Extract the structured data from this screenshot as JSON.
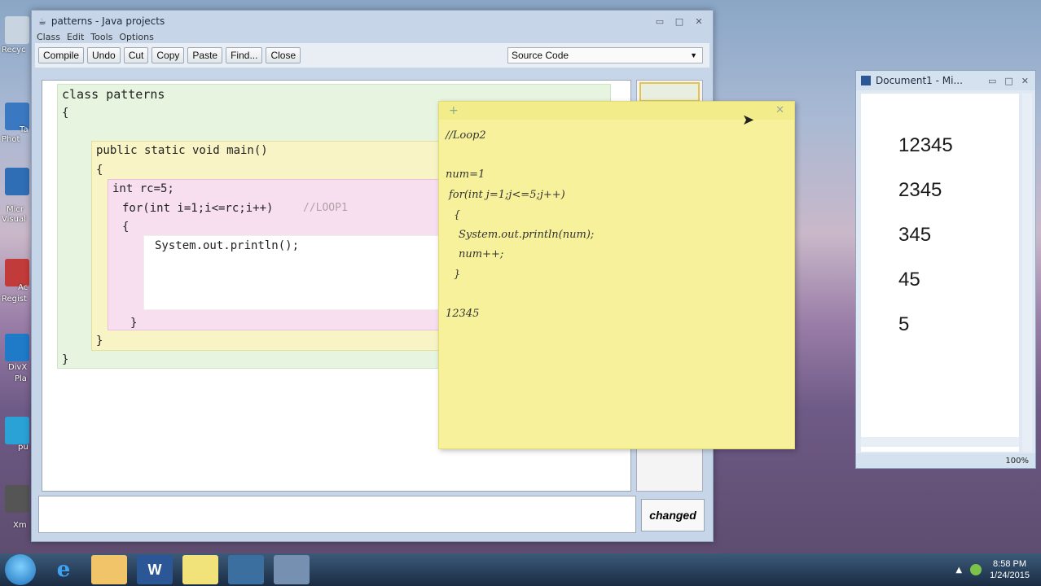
{
  "bluej": {
    "title": "patterns - Java projects",
    "menu": [
      "Class",
      "Edit",
      "Tools",
      "Options"
    ],
    "toolbar": [
      "Compile",
      "Undo",
      "Cut",
      "Copy",
      "Paste",
      "Find...",
      "Close"
    ],
    "view_select": "Source Code",
    "code": [
      "class patterns",
      "{",
      "public static void main()",
      "{",
      "int rc=5;",
      "for(int i=1;i<=rc;i++)",
      "//LOOP1",
      "{",
      "System.out.println();",
      "}",
      "}",
      "}"
    ],
    "status": "changed"
  },
  "sticky": {
    "lines": [
      "//Loop2",
      "num=1",
      "for(int j=1;j<=5;j++)",
      "{",
      "System.out.println(num);",
      "num++;",
      "}",
      "12345"
    ]
  },
  "word": {
    "title": "Document1 - Mi...",
    "lines": [
      "12345",
      "2345",
      "345",
      "45",
      "5"
    ],
    "zoom": "100%"
  },
  "taskbar": {
    "time": "8:58 PM",
    "date": "1/24/2015"
  },
  "desktop": {
    "labels": [
      "Recyc",
      "Ta",
      "Phot",
      "Micr",
      "Visual",
      "Ac",
      "Regist",
      "DivX",
      "Pla",
      "pu",
      "Xm"
    ]
  },
  "colors": {
    "sticky": "#f6f19a",
    "class_scope": "#e6f4e0",
    "method_scope": "#f8f4c6",
    "loop_scope": "#f8dff0"
  }
}
